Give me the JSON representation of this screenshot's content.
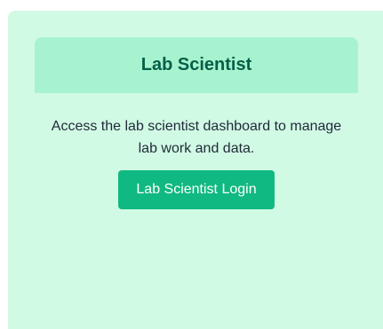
{
  "card": {
    "title": "Lab Scientist",
    "description": "Access the lab scientist dashboard to manage lab work and data.",
    "button_label": "Lab Scientist Login"
  },
  "colors": {
    "panel_bg": "#d1fae5",
    "header_bg": "#a7f3d0",
    "title_color": "#065f46",
    "button_bg": "#10b981",
    "button_text": "#ffffff"
  }
}
